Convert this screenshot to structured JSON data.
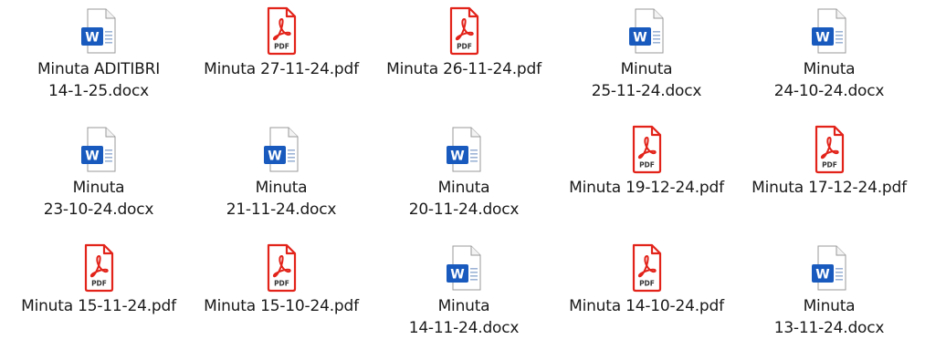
{
  "files": [
    {
      "name": "Minuta ADITIBRI\n14-1-25.docx",
      "type": "docx",
      "icon": "word-document-icon"
    },
    {
      "name": "Minuta 27-11-24.pdf",
      "type": "pdf",
      "icon": "pdf-document-icon"
    },
    {
      "name": "Minuta 26-11-24.pdf",
      "type": "pdf",
      "icon": "pdf-document-icon"
    },
    {
      "name": "Minuta\n25-11-24.docx",
      "type": "docx",
      "icon": "word-document-icon"
    },
    {
      "name": "Minuta\n24-10-24.docx",
      "type": "docx",
      "icon": "word-document-icon"
    },
    {
      "name": "Minuta\n23-10-24.docx",
      "type": "docx",
      "icon": "word-document-icon"
    },
    {
      "name": "Minuta\n21-11-24.docx",
      "type": "docx",
      "icon": "word-document-icon"
    },
    {
      "name": "Minuta\n20-11-24.docx",
      "type": "docx",
      "icon": "word-document-icon"
    },
    {
      "name": "Minuta 19-12-24.pdf",
      "type": "pdf",
      "icon": "pdf-document-icon"
    },
    {
      "name": "Minuta 17-12-24.pdf",
      "type": "pdf",
      "icon": "pdf-document-icon"
    },
    {
      "name": "Minuta 15-11-24.pdf",
      "type": "pdf",
      "icon": "pdf-document-icon"
    },
    {
      "name": "Minuta 15-10-24.pdf",
      "type": "pdf",
      "icon": "pdf-document-icon"
    },
    {
      "name": "Minuta\n14-11-24.docx",
      "type": "docx",
      "icon": "word-document-icon"
    },
    {
      "name": "Minuta 14-10-24.pdf",
      "type": "pdf",
      "icon": "pdf-document-icon"
    },
    {
      "name": "Minuta\n13-11-24.docx",
      "type": "docx",
      "icon": "word-document-icon"
    }
  ],
  "icon_labels": {
    "word_badge": "W",
    "pdf_badge": "PDF"
  },
  "colors": {
    "word_blue": "#185ABD",
    "pdf_red": "#E2231A",
    "page_border": "#9a9a9a"
  }
}
